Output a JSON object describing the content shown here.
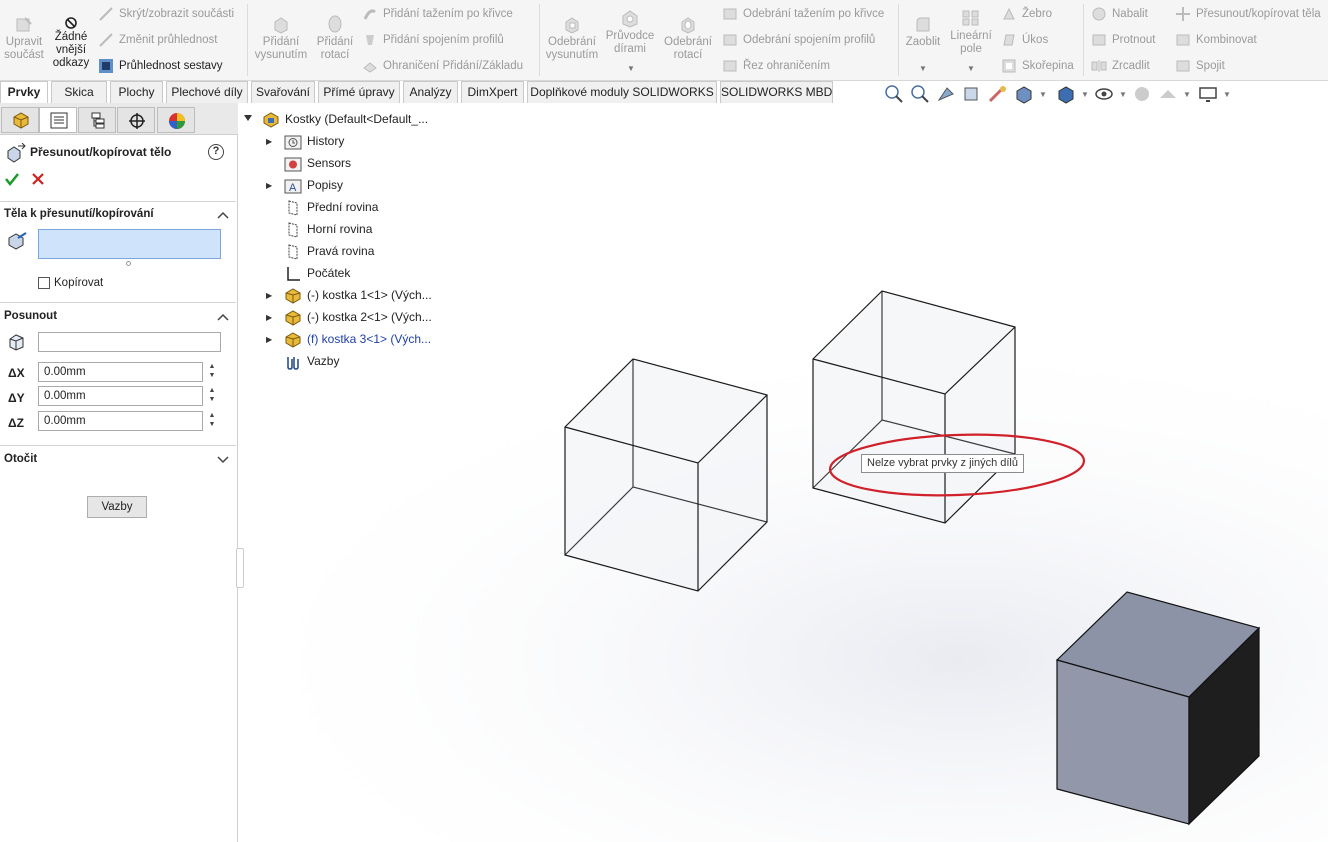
{
  "ribbon": {
    "upravit_soucast": [
      "Upravit",
      "součást"
    ],
    "zadne_odkazy": [
      "Žádné",
      "vnější",
      "odkazy"
    ],
    "skryt": "Skrýt/zobrazit součásti",
    "zmenit": "Změnit průhlednost",
    "pruhlednost": "Průhlednost sestavy",
    "pridani_vysunutim": [
      "Přidání",
      "vysunutím"
    ],
    "pridani_rotaci": [
      "Přidání",
      "rotací"
    ],
    "pridani_tazenim": "Přidání tažením po křivce",
    "pridani_spojenim": "Přidání spojením profilů",
    "ohraniceni": "Ohraničení Přidání/Základu",
    "odebrani_vysunutim": [
      "Odebrání",
      "vysunutím"
    ],
    "pruvodce_dirami": [
      "Průvodce",
      "dírami"
    ],
    "odebrani_rotaci": [
      "Odebrání",
      "rotací"
    ],
    "odebrani_tazenim": "Odebrání tažením po křivce",
    "odebrani_spojenim": "Odebrání spojením profilů",
    "rez": "Řez ohraničením",
    "zaoblit": "Zaoblit",
    "linearni_pole": [
      "Lineární",
      "pole"
    ],
    "zebro": "Žebro",
    "ukos": "Úkos",
    "skorepina": "Skořepina",
    "nabalit": "Nabalit",
    "protnout": "Protnout",
    "zrcadlit": "Zrcadlit",
    "presunout": "Přesunout/kopírovat těla",
    "kombinovat": "Kombinovat",
    "spojit": "Spojit"
  },
  "tabs": [
    "Prvky",
    "Skica",
    "Plochy",
    "Plechové díly",
    "Svařování",
    "Přímé úpravy",
    "Analýzy",
    "DimXpert",
    "Doplňkové moduly SOLIDWORKS",
    "SOLIDWORKS MBD"
  ],
  "panel": {
    "title": "Přesunout/kopírovat tělo",
    "help": "?",
    "section_bodies": "Těla k přesunutí/kopírování",
    "copy_label": "Kopírovat",
    "section_move": "Posunout",
    "dx_label": "ΔX",
    "dy_label": "ΔY",
    "dz_label": "ΔZ",
    "dx": "0.00mm",
    "dy": "0.00mm",
    "dz": "0.00mm",
    "section_rotate": "Otočit",
    "vazby_button": "Vazby"
  },
  "tree": {
    "root": "Kostky  (Default<Default_...",
    "items": [
      "History",
      "Sensors",
      "Popisy",
      "Přední rovina",
      "Horní rovina",
      "Pravá rovina",
      "Počátek",
      "(-) kostka 1<1> (Vých...",
      "(-) kostka 2<1> (Vých...",
      "(f) kostka 3<1> (Vých...",
      "Vazby"
    ]
  },
  "tooltip": "Nelze vybrat prvky z jiných dílů",
  "colors": {
    "accent": "#1f5fb8",
    "highlight_ring": "#d0202a",
    "solid_face_front": "#9298aa",
    "solid_face_side": "#1e1e1e",
    "solid_face_top": "#8d93a6"
  }
}
